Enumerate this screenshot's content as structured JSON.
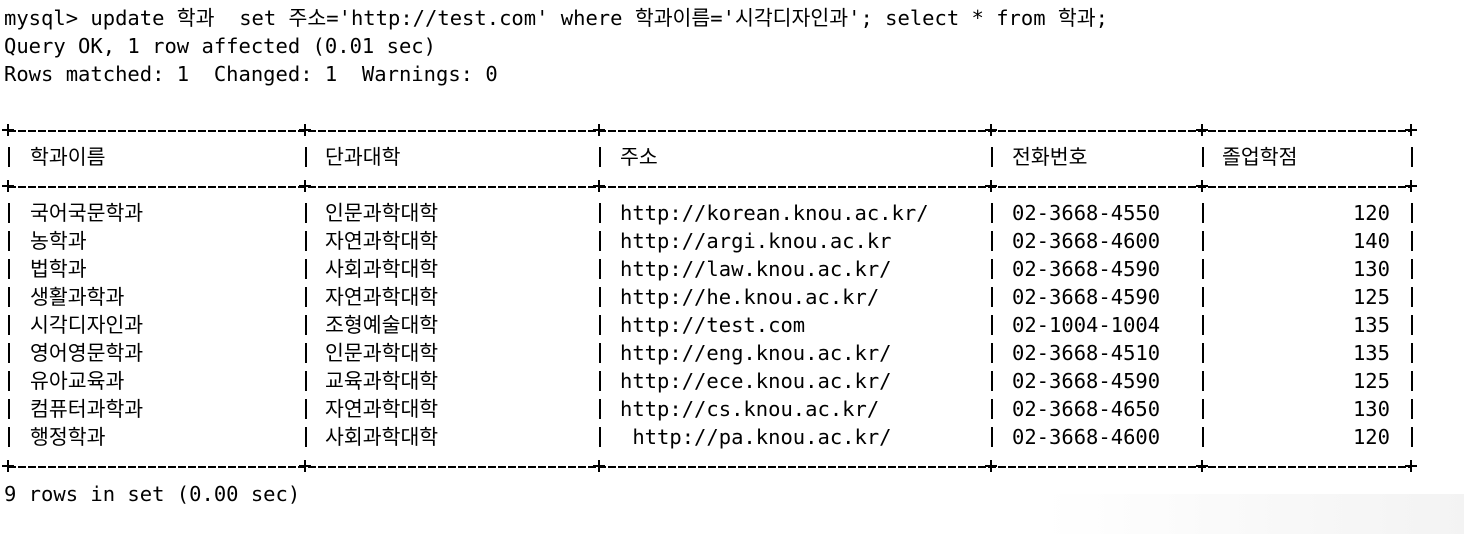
{
  "terminal": {
    "command_line": "mysql> update 학과  set 주소='http://test.com' where 학과이름='시각디자인과'; select * from 학과;",
    "result_line_1": "Query OK, 1 row affected (0.01 sec)",
    "result_line_2": "Rows matched: 1  Changed: 1  Warnings: 0",
    "footer_line": "9 rows in set (0.00 sec)"
  },
  "table": {
    "headers": [
      "학과이름",
      "단과대학",
      "주소",
      "전화번호",
      "졸업학점"
    ],
    "rows": [
      [
        "국어국문학과",
        "인문과학대학",
        "http://korean.knou.ac.kr/",
        "02-3668-4550",
        "120"
      ],
      [
        "농학과",
        "자연과학대학",
        "http://argi.knou.ac.kr",
        "02-3668-4600",
        "140"
      ],
      [
        "법학과",
        "사회과학대학",
        "http://law.knou.ac.kr/",
        "02-3668-4590",
        "130"
      ],
      [
        "생활과학과",
        "자연과학대학",
        "http://he.knou.ac.kr/",
        "02-3668-4590",
        "125"
      ],
      [
        "시각디자인과",
        "조형예술대학",
        "http://test.com",
        "02-1004-1004",
        "135"
      ],
      [
        "영어영문학과",
        "인문과학대학",
        "http://eng.knou.ac.kr/",
        "02-3668-4510",
        "135"
      ],
      [
        "유아교육과",
        "교육과학대학",
        "http://ece.knou.ac.kr/",
        "02-3668-4590",
        "125"
      ],
      [
        "컴퓨터과학과",
        "자연과학대학",
        "http://cs.knou.ac.kr/",
        "02-3668-4650",
        "130"
      ],
      [
        "행정학과",
        "사회과학대학",
        " http://pa.knou.ac.kr/",
        "02-3668-4600",
        "120"
      ]
    ]
  }
}
